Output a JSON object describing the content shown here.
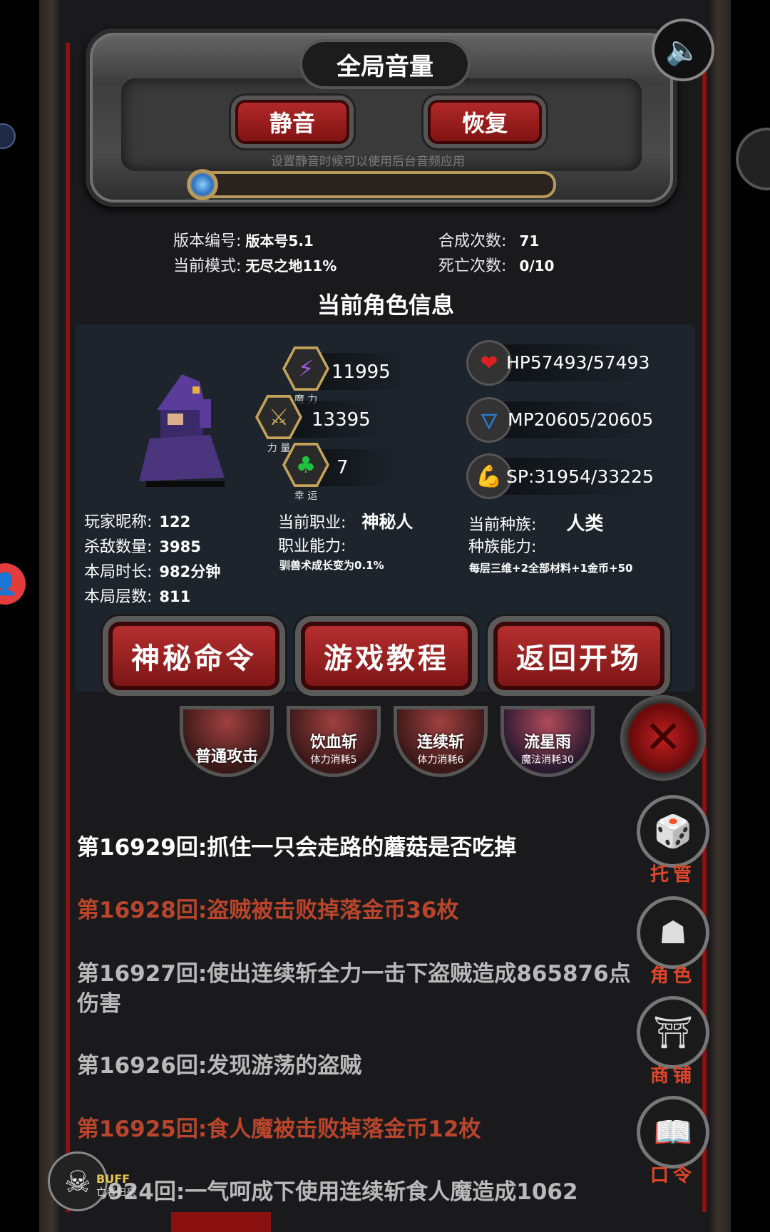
{
  "audio": {
    "title": "全局音量",
    "mute_label": "静音",
    "restore_label": "恢复",
    "hint": "设置静音时候可以使用后台音频应用",
    "volume_level": 0
  },
  "game_info": {
    "version_key": "版本编号:",
    "version_val": "版本号5.1",
    "mode_key": "当前模式:",
    "mode_val": "无尽之地11%",
    "craft_key": "合成次数:",
    "craft_val": "71",
    "death_key": "死亡次数:",
    "death_val": "0/10"
  },
  "character": {
    "section_title": "当前角色信息",
    "magic": {
      "value": "11995",
      "caption": "魔 力"
    },
    "strength": {
      "value": "13395",
      "caption": "力 量"
    },
    "luck": {
      "value": "7",
      "caption": "幸 运"
    },
    "hp": "HP57493/57493",
    "mp": "MP20605/20605",
    "sp": "SP:31954/33225",
    "nickname_key": "玩家昵称:",
    "nickname_val": "122",
    "kills_key": "杀敌数量:",
    "kills_val": "3985",
    "duration_key": "本局时长:",
    "duration_val": "982分钟",
    "floors_key": "本局层数:",
    "floors_val": "811",
    "job_key": "当前职业:",
    "job_val": "神秘人",
    "job_ability_key": "职业能力:",
    "job_ability_val": "驯兽术成长变为0.1%",
    "race_key": "当前种族:",
    "race_val": "人类",
    "race_ability_key": "种族能力:",
    "race_ability_val": "每层三维+2全部材料+1金币+50"
  },
  "actions": {
    "mystic_command": "神秘命令",
    "tutorial": "游戏教程",
    "return_start": "返回开场"
  },
  "skills": [
    {
      "name": "普通攻击",
      "cost": ""
    },
    {
      "name": "饮血斩",
      "cost": "体力消耗5"
    },
    {
      "name": "连续斩",
      "cost": "体力消耗6"
    },
    {
      "name": "流星雨",
      "cost": "魔法消耗30"
    }
  ],
  "log": [
    {
      "text": "第16929回:抓住一只会走路的蘑菇是否吃掉",
      "color": "#ffffff"
    },
    {
      "text": "第16928回:盗贼被击败掉落金币36枚",
      "color": "#b8452c"
    },
    {
      "text": "第16927回:使出连续斩全力一击下盗贼造成865876点伤害",
      "color": "#b9b9b9"
    },
    {
      "text": "第16926回:发现游荡的盗贼",
      "color": "#b9b9b9"
    },
    {
      "text": "第16925回:食人魔被击败掉落金币12枚",
      "color": "#b8452c"
    },
    {
      "text": "16924回:一气呵成下使用连续斩食人魔造成1062",
      "color": "#b9b9b9"
    }
  ],
  "side_menu": {
    "auto": "托管",
    "role": "角色",
    "shop": "商铺",
    "code": "口令"
  },
  "buff": {
    "label": "BUFF",
    "name": "亡者归来"
  },
  "colors": {
    "accent_red": "#8b1010",
    "gold": "#c6a35a",
    "log_red": "#b8452c"
  }
}
